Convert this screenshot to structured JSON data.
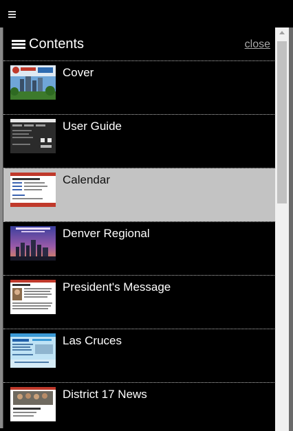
{
  "header": {
    "menu_icon": "hamburger-menu-icon"
  },
  "contents": {
    "title": "Contents",
    "close_label": "close",
    "items": [
      {
        "label": "Cover",
        "selected": false
      },
      {
        "label": "User Guide",
        "selected": false
      },
      {
        "label": "Calendar",
        "selected": true
      },
      {
        "label": "Denver Regional",
        "selected": false
      },
      {
        "label": "President's Message",
        "selected": false
      },
      {
        "label": "Las Cruces",
        "selected": false
      },
      {
        "label": "District 17 News",
        "selected": false
      }
    ]
  },
  "colors": {
    "panel_background": "#000000",
    "selected_background": "#c3c3c3",
    "close_link": "#aaaaaa"
  }
}
